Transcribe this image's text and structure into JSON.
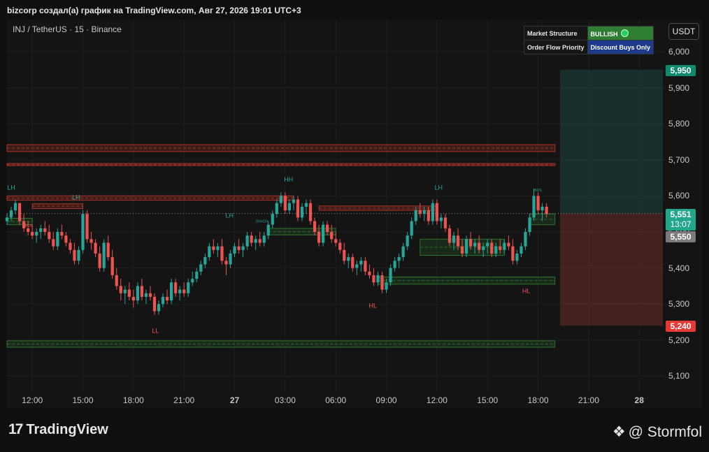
{
  "caption": "bizcorp создал(а) график на TradingView.com, Авг 27, 2026 19:01 UTC+3",
  "symbol_line": "INJ / TetherUS · 15 · Binance",
  "currency_button": "USDT",
  "info_table": {
    "rows": [
      {
        "label": "Market Structure",
        "value": "BULLISH",
        "color": "#2e7d32"
      },
      {
        "label": "Order Flow Priority",
        "value": "Discount Buys Only",
        "color": "#1e3a8a"
      }
    ]
  },
  "price_badges": {
    "target": "5,950",
    "last": "5,551",
    "countdown": "13:07",
    "mark": "5,550",
    "stop": "5,240"
  },
  "footer": {
    "brand": "TradingView",
    "watermark": "@ Stormfol"
  },
  "chart_data": {
    "type": "candlestick",
    "y_ticks": [
      "6,000",
      "5,900",
      "5,800",
      "5,700",
      "5,600",
      "5,500",
      "5,400",
      "5,300",
      "5,200",
      "5,100"
    ],
    "y_tick_values": [
      6.0,
      5.9,
      5.8,
      5.7,
      5.6,
      5.5,
      5.4,
      5.3,
      5.2,
      5.1
    ],
    "ylim": [
      5.06,
      6.07
    ],
    "x_ticks": [
      "12:00",
      "15:00",
      "18:00",
      "21:00",
      "27",
      "03:00",
      "06:00",
      "09:00",
      "12:00",
      "15:00",
      "18:00",
      "21:00",
      "28"
    ],
    "x_tick_hours": [
      0,
      3,
      6,
      9,
      12,
      15,
      18,
      21,
      24,
      27,
      30,
      33,
      36
    ],
    "x_range_hours": [
      -1.5,
      37.4
    ],
    "colors": {
      "up": "#26a69a",
      "down": "#ef5350",
      "supply": "#c0392b",
      "demand": "#2e7d32"
    },
    "candles": [
      [
        -1.5,
        5.53,
        5.55,
        5.52,
        5.54
      ],
      [
        -1.25,
        5.54,
        5.57,
        5.53,
        5.56
      ],
      [
        -1.0,
        5.56,
        5.59,
        5.55,
        5.58
      ],
      [
        -0.75,
        5.58,
        5.58,
        5.52,
        5.53
      ],
      [
        -0.5,
        5.53,
        5.55,
        5.5,
        5.51
      ],
      [
        -0.25,
        5.51,
        5.53,
        5.49,
        5.5
      ],
      [
        0.0,
        5.5,
        5.52,
        5.48,
        5.49
      ],
      [
        0.25,
        5.49,
        5.51,
        5.47,
        5.5
      ],
      [
        0.5,
        5.5,
        5.52,
        5.48,
        5.51
      ],
      [
        0.75,
        5.51,
        5.53,
        5.49,
        5.5
      ],
      [
        1.0,
        5.5,
        5.52,
        5.47,
        5.48
      ],
      [
        1.25,
        5.48,
        5.5,
        5.45,
        5.46
      ],
      [
        1.5,
        5.46,
        5.51,
        5.45,
        5.5
      ],
      [
        1.75,
        5.5,
        5.52,
        5.48,
        5.49
      ],
      [
        2.0,
        5.49,
        5.5,
        5.46,
        5.47
      ],
      [
        2.25,
        5.47,
        5.48,
        5.44,
        5.45
      ],
      [
        2.5,
        5.45,
        5.47,
        5.41,
        5.42
      ],
      [
        2.75,
        5.42,
        5.46,
        5.41,
        5.45
      ],
      [
        3.0,
        5.45,
        5.56,
        5.44,
        5.55
      ],
      [
        3.25,
        5.55,
        5.56,
        5.47,
        5.48
      ],
      [
        3.5,
        5.48,
        5.5,
        5.45,
        5.47
      ],
      [
        3.75,
        5.47,
        5.48,
        5.43,
        5.44
      ],
      [
        4.0,
        5.44,
        5.46,
        5.39,
        5.4
      ],
      [
        4.25,
        5.4,
        5.48,
        5.39,
        5.47
      ],
      [
        4.5,
        5.47,
        5.49,
        5.42,
        5.43
      ],
      [
        4.75,
        5.43,
        5.45,
        5.37,
        5.38
      ],
      [
        5.0,
        5.38,
        5.4,
        5.34,
        5.35
      ],
      [
        5.25,
        5.35,
        5.37,
        5.31,
        5.33
      ],
      [
        5.5,
        5.33,
        5.35,
        5.3,
        5.34
      ],
      [
        5.75,
        5.34,
        5.36,
        5.31,
        5.32
      ],
      [
        6.0,
        5.32,
        5.34,
        5.29,
        5.31
      ],
      [
        6.25,
        5.31,
        5.36,
        5.3,
        5.35
      ],
      [
        6.5,
        5.35,
        5.37,
        5.31,
        5.32
      ],
      [
        6.75,
        5.32,
        5.34,
        5.3,
        5.33
      ],
      [
        7.0,
        5.33,
        5.35,
        5.31,
        5.32
      ],
      [
        7.25,
        5.32,
        5.33,
        5.27,
        5.28
      ],
      [
        7.5,
        5.28,
        5.31,
        5.27,
        5.3
      ],
      [
        7.75,
        5.3,
        5.33,
        5.29,
        5.32
      ],
      [
        8.0,
        5.32,
        5.34,
        5.3,
        5.31
      ],
      [
        8.25,
        5.31,
        5.37,
        5.3,
        5.36
      ],
      [
        8.5,
        5.36,
        5.37,
        5.32,
        5.33
      ],
      [
        8.75,
        5.33,
        5.35,
        5.31,
        5.34
      ],
      [
        9.0,
        5.34,
        5.36,
        5.32,
        5.33
      ],
      [
        9.25,
        5.33,
        5.37,
        5.32,
        5.36
      ],
      [
        9.5,
        5.36,
        5.39,
        5.35,
        5.37
      ],
      [
        9.75,
        5.37,
        5.4,
        5.36,
        5.39
      ],
      [
        10.0,
        5.39,
        5.42,
        5.38,
        5.41
      ],
      [
        10.25,
        5.41,
        5.44,
        5.4,
        5.43
      ],
      [
        10.5,
        5.43,
        5.47,
        5.42,
        5.46
      ],
      [
        10.75,
        5.46,
        5.48,
        5.44,
        5.45
      ],
      [
        11.0,
        5.45,
        5.47,
        5.43,
        5.46
      ],
      [
        11.25,
        5.46,
        5.48,
        5.41,
        5.42
      ],
      [
        11.5,
        5.42,
        5.43,
        5.38,
        5.41
      ],
      [
        11.75,
        5.41,
        5.45,
        5.4,
        5.44
      ],
      [
        12.0,
        5.44,
        5.47,
        5.43,
        5.46
      ],
      [
        12.25,
        5.46,
        5.48,
        5.44,
        5.45
      ],
      [
        12.5,
        5.45,
        5.47,
        5.43,
        5.46
      ],
      [
        12.75,
        5.46,
        5.5,
        5.45,
        5.49
      ],
      [
        13.0,
        5.49,
        5.5,
        5.46,
        5.47
      ],
      [
        13.25,
        5.47,
        5.49,
        5.45,
        5.48
      ],
      [
        13.5,
        5.48,
        5.5,
        5.46,
        5.47
      ],
      [
        13.75,
        5.47,
        5.5,
        5.46,
        5.49
      ],
      [
        14.0,
        5.49,
        5.53,
        5.48,
        5.52
      ],
      [
        14.25,
        5.52,
        5.56,
        5.51,
        5.55
      ],
      [
        14.5,
        5.55,
        5.59,
        5.54,
        5.58
      ],
      [
        14.75,
        5.58,
        5.61,
        5.57,
        5.6
      ],
      [
        15.0,
        5.6,
        5.61,
        5.55,
        5.56
      ],
      [
        15.25,
        5.56,
        5.59,
        5.55,
        5.58
      ],
      [
        15.5,
        5.58,
        5.6,
        5.56,
        5.59
      ],
      [
        15.75,
        5.59,
        5.6,
        5.53,
        5.54
      ],
      [
        16.0,
        5.54,
        5.58,
        5.53,
        5.57
      ],
      [
        16.25,
        5.57,
        5.59,
        5.55,
        5.58
      ],
      [
        16.5,
        5.58,
        5.59,
        5.52,
        5.53
      ],
      [
        16.75,
        5.53,
        5.54,
        5.49,
        5.5
      ],
      [
        17.0,
        5.5,
        5.52,
        5.46,
        5.47
      ],
      [
        17.25,
        5.47,
        5.53,
        5.46,
        5.52
      ],
      [
        17.5,
        5.52,
        5.53,
        5.49,
        5.5
      ],
      [
        17.75,
        5.5,
        5.52,
        5.47,
        5.48
      ],
      [
        18.0,
        5.48,
        5.5,
        5.46,
        5.47
      ],
      [
        18.25,
        5.47,
        5.48,
        5.44,
        5.45
      ],
      [
        18.5,
        5.45,
        5.47,
        5.41,
        5.42
      ],
      [
        18.75,
        5.42,
        5.44,
        5.4,
        5.43
      ],
      [
        19.0,
        5.43,
        5.44,
        5.39,
        5.4
      ],
      [
        19.25,
        5.4,
        5.42,
        5.38,
        5.41
      ],
      [
        19.5,
        5.41,
        5.43,
        5.39,
        5.42
      ],
      [
        19.75,
        5.42,
        5.43,
        5.38,
        5.39
      ],
      [
        20.0,
        5.39,
        5.41,
        5.37,
        5.38
      ],
      [
        20.25,
        5.38,
        5.4,
        5.35,
        5.36
      ],
      [
        20.5,
        5.36,
        5.39,
        5.35,
        5.38
      ],
      [
        20.75,
        5.38,
        5.39,
        5.33,
        5.34
      ],
      [
        21.0,
        5.34,
        5.37,
        5.33,
        5.36
      ],
      [
        21.25,
        5.36,
        5.41,
        5.35,
        5.4
      ],
      [
        21.5,
        5.4,
        5.43,
        5.39,
        5.42
      ],
      [
        21.75,
        5.42,
        5.44,
        5.4,
        5.43
      ],
      [
        22.0,
        5.43,
        5.47,
        5.42,
        5.46
      ],
      [
        22.25,
        5.46,
        5.5,
        5.45,
        5.49
      ],
      [
        22.5,
        5.49,
        5.54,
        5.48,
        5.53
      ],
      [
        22.75,
        5.53,
        5.57,
        5.52,
        5.56
      ],
      [
        23.0,
        5.56,
        5.58,
        5.54,
        5.55
      ],
      [
        23.25,
        5.55,
        5.57,
        5.53,
        5.56
      ],
      [
        23.5,
        5.56,
        5.57,
        5.52,
        5.53
      ],
      [
        23.75,
        5.53,
        5.59,
        5.52,
        5.58
      ],
      [
        24.0,
        5.58,
        5.59,
        5.52,
        5.53
      ],
      [
        24.25,
        5.53,
        5.55,
        5.51,
        5.54
      ],
      [
        24.5,
        5.54,
        5.55,
        5.5,
        5.51
      ],
      [
        24.75,
        5.51,
        5.52,
        5.46,
        5.47
      ],
      [
        25.0,
        5.47,
        5.5,
        5.45,
        5.49
      ],
      [
        25.25,
        5.49,
        5.51,
        5.45,
        5.46
      ],
      [
        25.5,
        5.46,
        5.48,
        5.43,
        5.44
      ],
      [
        25.75,
        5.44,
        5.49,
        5.43,
        5.48
      ],
      [
        26.0,
        5.48,
        5.5,
        5.45,
        5.46
      ],
      [
        26.25,
        5.46,
        5.48,
        5.44,
        5.47
      ],
      [
        26.5,
        5.47,
        5.49,
        5.44,
        5.45
      ],
      [
        26.75,
        5.45,
        5.47,
        5.43,
        5.46
      ],
      [
        27.0,
        5.46,
        5.48,
        5.44,
        5.47
      ],
      [
        27.25,
        5.47,
        5.48,
        5.43,
        5.44
      ],
      [
        27.5,
        5.44,
        5.47,
        5.43,
        5.46
      ],
      [
        27.75,
        5.46,
        5.48,
        5.44,
        5.45
      ],
      [
        28.0,
        5.45,
        5.48,
        5.44,
        5.47
      ],
      [
        28.25,
        5.47,
        5.49,
        5.45,
        5.46
      ],
      [
        28.5,
        5.46,
        5.48,
        5.41,
        5.42
      ],
      [
        28.75,
        5.42,
        5.45,
        5.41,
        5.44
      ],
      [
        29.0,
        5.44,
        5.47,
        5.43,
        5.46
      ],
      [
        29.25,
        5.46,
        5.51,
        5.45,
        5.5
      ],
      [
        29.5,
        5.5,
        5.55,
        5.49,
        5.54
      ],
      [
        29.75,
        5.54,
        5.62,
        5.53,
        5.6
      ],
      [
        30.0,
        5.6,
        5.61,
        5.55,
        5.56
      ],
      [
        30.25,
        5.56,
        5.58,
        5.53,
        5.57
      ],
      [
        30.5,
        5.57,
        5.58,
        5.54,
        5.55
      ]
    ],
    "structure_labels": [
      {
        "text": "LH",
        "t": -1.25,
        "p": 5.617,
        "color": "#26a69a"
      },
      {
        "text": "LH",
        "t": 2.6,
        "p": 5.59,
        "color": "#26a69a"
      },
      {
        "text": "LL",
        "t": 7.3,
        "p": 5.22,
        "color": "#ef5350"
      },
      {
        "text": "LH",
        "t": 11.7,
        "p": 5.54,
        "color": "#26a69a"
      },
      {
        "text": "HH",
        "t": 15.2,
        "p": 5.64,
        "color": "#26a69a"
      },
      {
        "text": "HL",
        "t": 20.2,
        "p": 5.29,
        "color": "#ef5350"
      },
      {
        "text": "LH",
        "t": 24.1,
        "p": 5.617,
        "color": "#26a69a"
      },
      {
        "text": "HL",
        "t": 29.3,
        "p": 5.33,
        "color": "#ef5350"
      }
    ],
    "small_labels": [
      {
        "text": "BOS",
        "t": -0.2,
        "p": 5.514,
        "color": "#ef5350"
      },
      {
        "text": "CHoCH",
        "t": 13.6,
        "p": 5.526,
        "color": "#26a69a"
      },
      {
        "text": "BOS",
        "t": 30.0,
        "p": 5.612,
        "color": "#26a69a"
      }
    ],
    "zones": [
      {
        "kind": "supply",
        "t0": -1.5,
        "t1": 31.0,
        "p0": 5.723,
        "p1": 5.742
      },
      {
        "kind": "supply",
        "t0": -1.5,
        "t1": 31.0,
        "p0": 5.684,
        "p1": 5.69
      },
      {
        "kind": "supply",
        "t0": -1.5,
        "t1": 15.5,
        "p0": 5.588,
        "p1": 5.6
      },
      {
        "kind": "supply",
        "t0": 0.0,
        "t1": 3.0,
        "p0": 5.565,
        "p1": 5.578
      },
      {
        "kind": "supply",
        "t0": 17.0,
        "t1": 24.0,
        "p0": 5.56,
        "p1": 5.572
      },
      {
        "kind": "demand",
        "t0": -1.5,
        "t1": 0.0,
        "p0": 5.52,
        "p1": 5.538
      },
      {
        "kind": "demand",
        "t0": 14.0,
        "t1": 18.0,
        "p0": 5.492,
        "p1": 5.51
      },
      {
        "kind": "demand",
        "t0": 23.0,
        "t1": 28.0,
        "p0": 5.435,
        "p1": 5.48
      },
      {
        "kind": "demand",
        "t0": 20.5,
        "t1": 31.0,
        "p0": 5.355,
        "p1": 5.375
      },
      {
        "kind": "demand",
        "t0": 29.5,
        "t1": 31.0,
        "p0": 5.52,
        "p1": 5.55
      },
      {
        "kind": "demand",
        "t0": -1.5,
        "t1": 31.0,
        "p0": 5.18,
        "p1": 5.198
      }
    ],
    "position": {
      "t0": 31.3,
      "t1": 37.4,
      "entry": 5.551,
      "target": 5.95,
      "stop": 5.24
    },
    "last_price": 5.551
  }
}
